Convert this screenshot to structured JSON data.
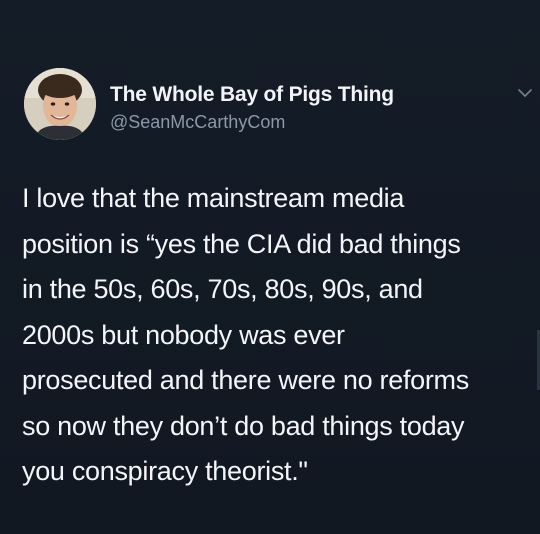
{
  "account": {
    "display_name": "The Whole Bay of Pigs Thing",
    "handle": "@SeanMcCarthyCom"
  },
  "menu": {
    "icon": "chevron-down-icon"
  },
  "tweet": {
    "lines": [
      "I love that the mainstream media",
      "position is “yes the CIA did bad things",
      "in the 50s, 60s, 70s, 80s, 90s, and",
      "2000s but nobody was ever",
      "prosecuted and there were no reforms",
      "so now they don’t do bad things today",
      "you conspiracy theorist.\""
    ]
  },
  "colors": {
    "background": "#121a24",
    "text": "#f3f5f8",
    "secondary_text": "#8b98a7"
  }
}
